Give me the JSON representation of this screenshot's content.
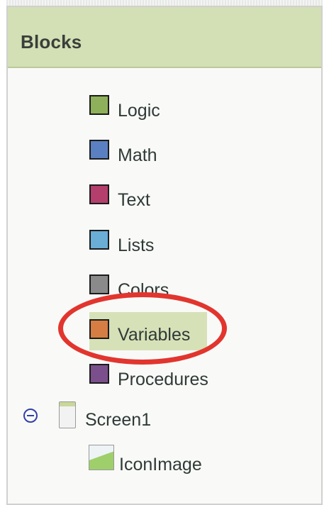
{
  "panel": {
    "title": "Blocks"
  },
  "categories": [
    {
      "label": "Logic",
      "color": "#8fb05a"
    },
    {
      "label": "Math",
      "color": "#5b80c1"
    },
    {
      "label": "Text",
      "color": "#b43f6c"
    },
    {
      "label": "Lists",
      "color": "#6aadd5"
    },
    {
      "label": "Colors",
      "color": "#8a8a8a"
    },
    {
      "label": "Variables",
      "color": "#d57d43",
      "selected": true
    },
    {
      "label": "Procedures",
      "color": "#7b4f8c"
    }
  ],
  "tree": {
    "screen": {
      "label": "Screen1",
      "expanded": true
    },
    "component": {
      "label": "IconImage"
    }
  },
  "annotation": {
    "color": "#e2352e",
    "target": "Variables"
  }
}
